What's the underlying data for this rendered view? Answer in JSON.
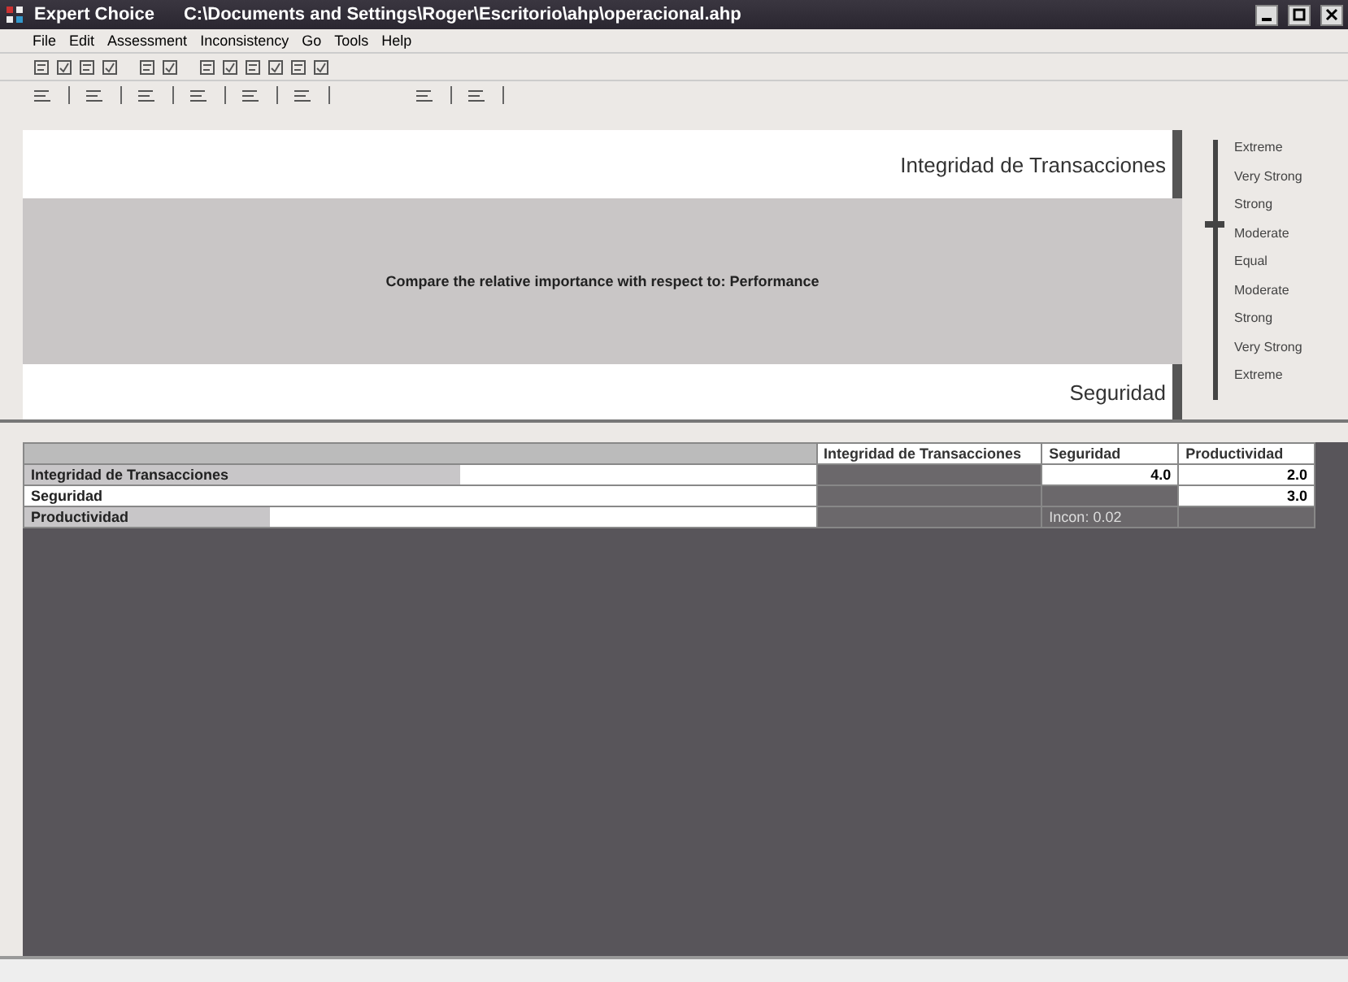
{
  "window": {
    "title": "Expert Choice",
    "path": "C:\\Documents and Settings\\Roger\\Escritorio\\ahp\\operacional.ahp"
  },
  "menu": [
    "File",
    "Edit",
    "Assessment",
    "Inconsistency",
    "Go",
    "Tools",
    "Help"
  ],
  "comparison": {
    "top_item": "Integridad de Transacciones",
    "prompt": "Compare the relative importance with respect to: Performance",
    "bottom_item": "Seguridad"
  },
  "scale": {
    "level": 0.66,
    "labels": [
      "Extreme",
      "Very Strong",
      "Strong",
      "Moderate",
      "Equal",
      "Moderate",
      "Strong",
      "Very Strong",
      "Extreme"
    ]
  },
  "matrix": {
    "columns": [
      "Integridad de Transacciones",
      "Seguridad",
      "Productividad"
    ],
    "rows": [
      {
        "label": "Integridad de Transacciones",
        "level": 0.55,
        "cells": [
          {
            "text": "",
            "shaded": true
          },
          {
            "text": "4.0",
            "shaded": false
          },
          {
            "text": "2.0",
            "shaded": false
          }
        ]
      },
      {
        "label": "Seguridad",
        "level": 0,
        "cells": [
          {
            "text": "",
            "shaded": true
          },
          {
            "text": "",
            "shaded": true
          },
          {
            "text": "3.0",
            "shaded": false
          }
        ]
      },
      {
        "label": "Productividad",
        "level": 0.31,
        "cells": [
          {
            "text": "",
            "shaded": true
          },
          {
            "text": "Incon: 0.02",
            "shaded": true
          },
          {
            "text": "",
            "shaded": true
          }
        ]
      }
    ]
  }
}
